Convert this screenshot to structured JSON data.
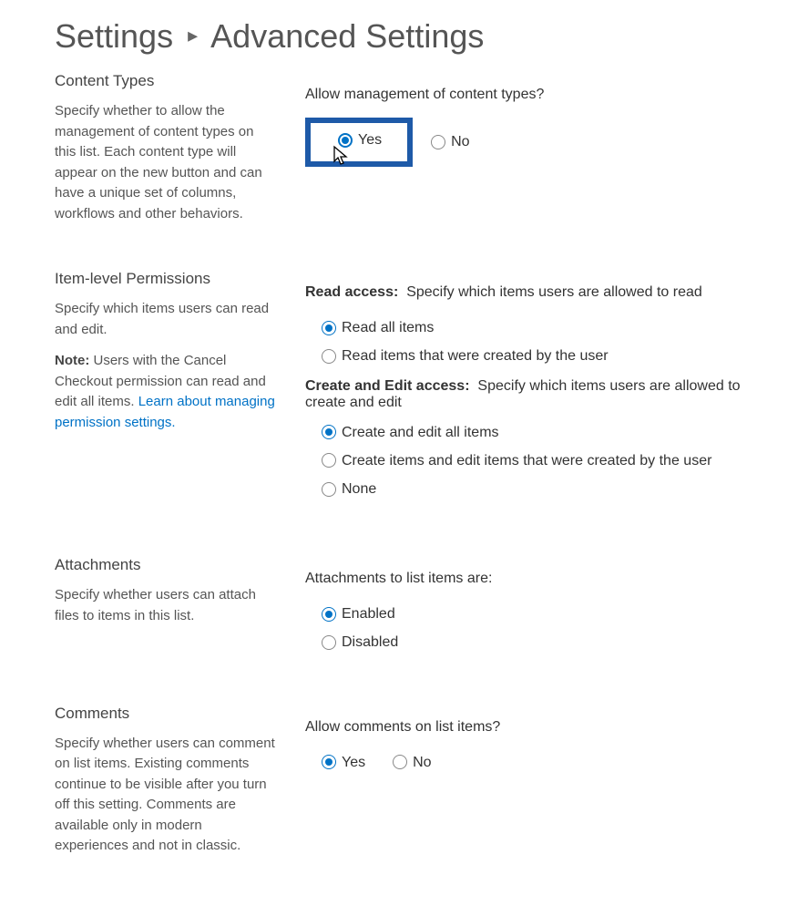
{
  "breadcrumb": {
    "parent": "Settings",
    "current": "Advanced Settings"
  },
  "sections": {
    "contentTypes": {
      "title": "Content Types",
      "desc": "Specify whether to allow the management of content types on this list. Each content type will appear on the new button and can have a unique set of columns, workflows and other behaviors.",
      "question": "Allow management of content types?",
      "yes": "Yes",
      "no": "No"
    },
    "itemLevel": {
      "title": "Item-level Permissions",
      "desc1": "Specify which items users can read and edit.",
      "noteLabel": "Note:",
      "noteText": " Users with the Cancel Checkout permission can read and edit all items. ",
      "link": "Learn about managing permission settings.",
      "readLabel": "Read access:",
      "readDesc": "Specify which items users are allowed to read",
      "readOpt1": "Read all items",
      "readOpt2": "Read items that were created by the user",
      "createLabel": "Create and Edit access:",
      "createDesc": "Specify which items users are allowed to create and edit",
      "createOpt1": "Create and edit all items",
      "createOpt2": "Create items and edit items that were created by the user",
      "createOpt3": "None"
    },
    "attachments": {
      "title": "Attachments",
      "desc": "Specify whether users can attach files to items in this list.",
      "question": "Attachments to list items are:",
      "enabled": "Enabled",
      "disabled": "Disabled"
    },
    "comments": {
      "title": "Comments",
      "desc": "Specify whether users can comment on list items. Existing comments continue to be visible after you turn off this setting. Comments are available only in modern experiences and not in classic.",
      "question": "Allow comments on list items?",
      "yes": "Yes",
      "no": "No"
    }
  }
}
